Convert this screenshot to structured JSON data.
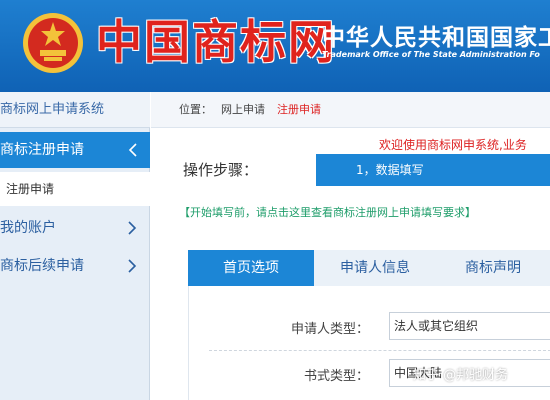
{
  "header": {
    "brand_text": "中国商标网",
    "org_cn": "中华人民共和国国家工",
    "org_en": "Trademark Office of The State Administration Fo"
  },
  "sidebar": {
    "title": "商标网上申请系统",
    "active_item": "商标注册申请",
    "sub_item": "注册申请",
    "items": [
      {
        "label": "我的账户"
      },
      {
        "label": "商标后续申请"
      }
    ]
  },
  "breadcrumb": {
    "prefix": "位置：",
    "item1": "网上申请",
    "item2": "注册申请"
  },
  "welcome": "欢迎使用商标网申系统,业务",
  "steps": {
    "label": "操作步骤：",
    "current": "1，数据填写"
  },
  "hint": "【开始填写前，请点击这里查看商标注册网上申请填写要求】",
  "tabs": [
    {
      "label": "首页选项"
    },
    {
      "label": "申请人信息"
    },
    {
      "label": "商标声明"
    }
  ],
  "form": {
    "applicant_type_label": "申请人类型：",
    "applicant_type_value": "法人或其它组织",
    "doc_type_label": "书式类型：",
    "doc_type_value": "中国大陆"
  },
  "watermark": "知乎 @邦驰财务",
  "colors": {
    "header_blue": "#1f7fd0",
    "accent_blue": "#1c86d6",
    "brand_red": "#e0231d",
    "hint_green": "#1e9d6a"
  }
}
